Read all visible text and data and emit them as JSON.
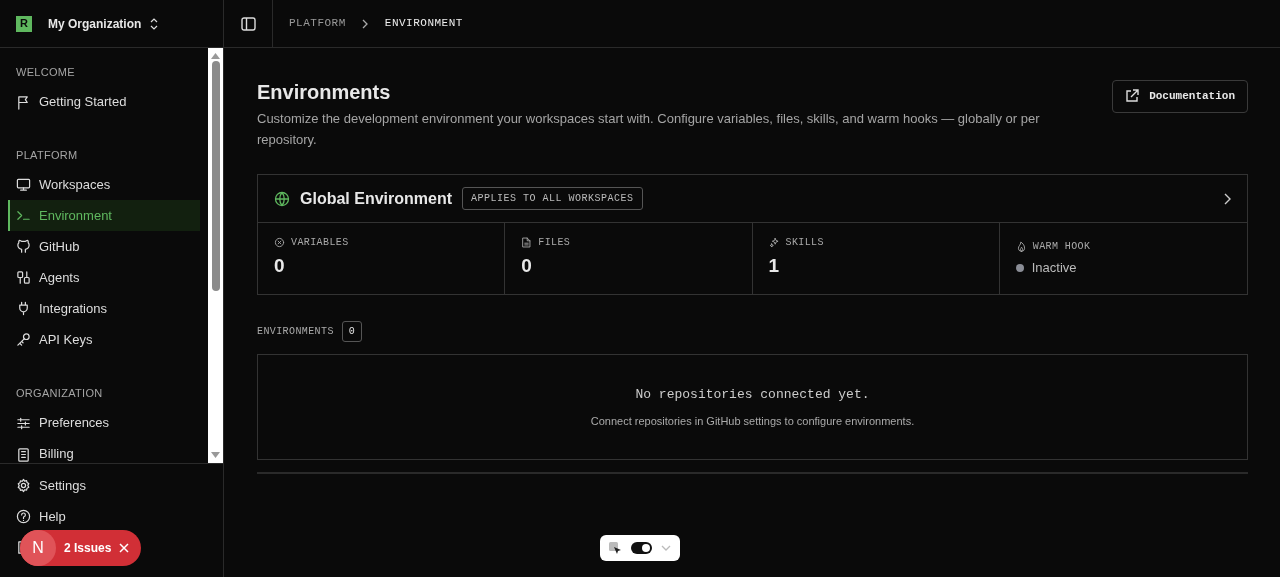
{
  "organization": {
    "logo": "R",
    "name": "My Organization"
  },
  "breadcrumb": [
    {
      "label": "PLATFORM",
      "current": false
    },
    {
      "label": "ENVIRONMENT",
      "current": true
    }
  ],
  "sidebar": {
    "sections": [
      {
        "title": "WELCOME",
        "items": [
          {
            "label": "Getting Started",
            "selected": false
          }
        ]
      },
      {
        "title": "PLATFORM",
        "items": [
          {
            "label": "Workspaces",
            "selected": false
          },
          {
            "label": "Environment",
            "selected": true
          },
          {
            "label": "GitHub",
            "selected": false
          },
          {
            "label": "Agents",
            "selected": false
          },
          {
            "label": "Integrations",
            "selected": false
          },
          {
            "label": "API Keys",
            "selected": false
          }
        ]
      },
      {
        "title": "ORGANIZATION",
        "items": [
          {
            "label": "Preferences",
            "selected": false
          },
          {
            "label": "Billing",
            "selected": false
          }
        ]
      }
    ],
    "footer_items": [
      {
        "label": "Settings"
      },
      {
        "label": "Help"
      }
    ]
  },
  "page": {
    "title": "Environments",
    "description": "Customize the development environment your workspaces start with. Configure variables, files, skills, and warm hooks — globally or per repository.",
    "docs_button": "Documentation"
  },
  "global_environment": {
    "title": "Global Environment",
    "badge": "APPLIES TO ALL WORKSPACES",
    "stats": [
      {
        "label": "VARIABLES",
        "value": "0"
      },
      {
        "label": "FILES",
        "value": "0"
      },
      {
        "label": "SKILLS",
        "value": "1"
      },
      {
        "label": "WARM HOOK",
        "status": "Inactive",
        "active": false
      }
    ]
  },
  "environments": {
    "title": "ENVIRONMENTS",
    "count": "0",
    "empty_title": "No repositories connected yet.",
    "empty_hint": "Connect repositories in GitHub settings to configure environments."
  },
  "issues_toast": {
    "avatar": "N",
    "text": "2 Issues"
  },
  "dev_toolbar": {
    "toggle_on": true
  }
}
